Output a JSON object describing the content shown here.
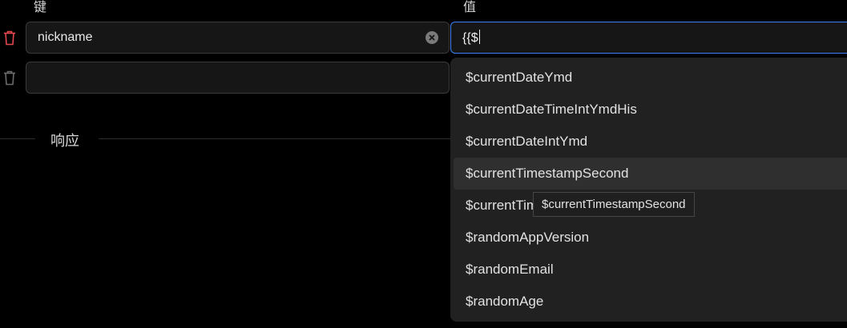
{
  "headers": {
    "key": "键",
    "value": "值"
  },
  "rows": [
    {
      "key": "nickname",
      "value": "{{$"
    },
    {
      "key": "",
      "value": ""
    }
  ],
  "section": {
    "response_label": "响应"
  },
  "autocomplete": {
    "items": [
      "$currentDateYmd",
      "$currentDateTimeIntYmdHis",
      "$currentDateIntYmd",
      "$currentTimestampSecond",
      "$currentTimestampMillisecond",
      "$randomAppVersion",
      "$randomEmail",
      "$randomAge"
    ],
    "hovered_index": 3,
    "tooltip": "$currentTimestampSecond"
  },
  "colors": {
    "delete_active": "#e5484d",
    "delete_inactive": "#6b6b6b",
    "focus_border": "#3b82f6"
  },
  "icons": {
    "delete": "trash-icon",
    "clear": "clear-circle-icon"
  }
}
